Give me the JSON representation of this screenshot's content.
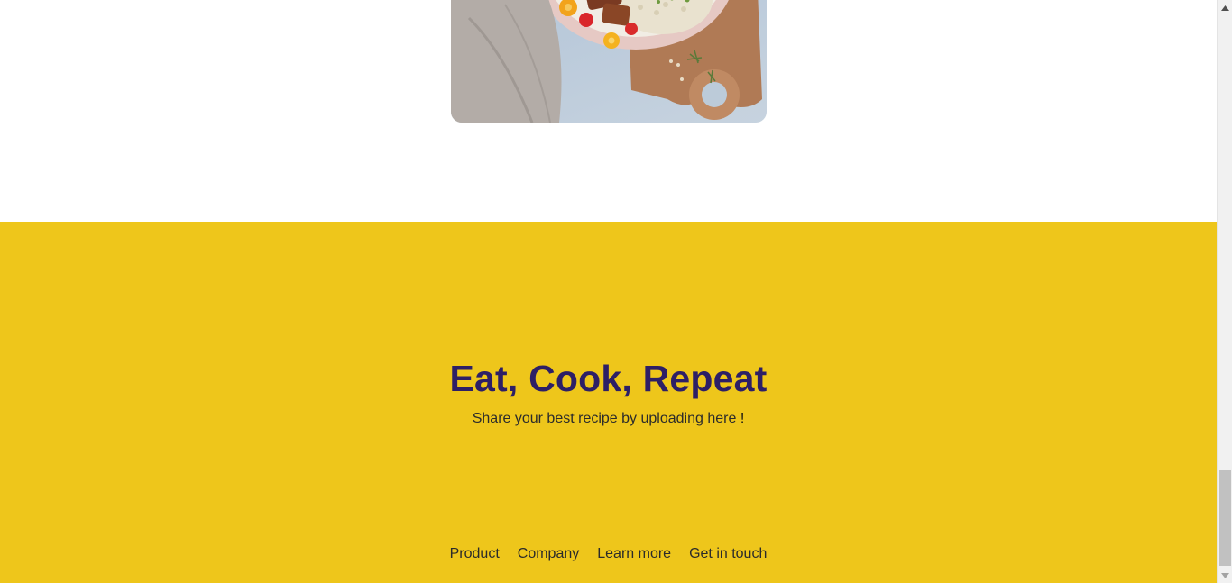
{
  "hero_image": {
    "alt": "food-bowl-image"
  },
  "footer": {
    "headline": "Eat, Cook, Repeat",
    "tagline_before": "Share your best recipe by uploading",
    "tagline_link": "here",
    "tagline_after": "!",
    "links": [
      "Product",
      "Company",
      "Learn more",
      "Get in touch"
    ]
  },
  "colors": {
    "footer_bg": "#eec61b",
    "headline": "#2d1f66",
    "text": "#2b2b2b"
  },
  "icons": {
    "scroll_up": "triangle-up-icon",
    "scroll_down": "triangle-down-icon"
  }
}
